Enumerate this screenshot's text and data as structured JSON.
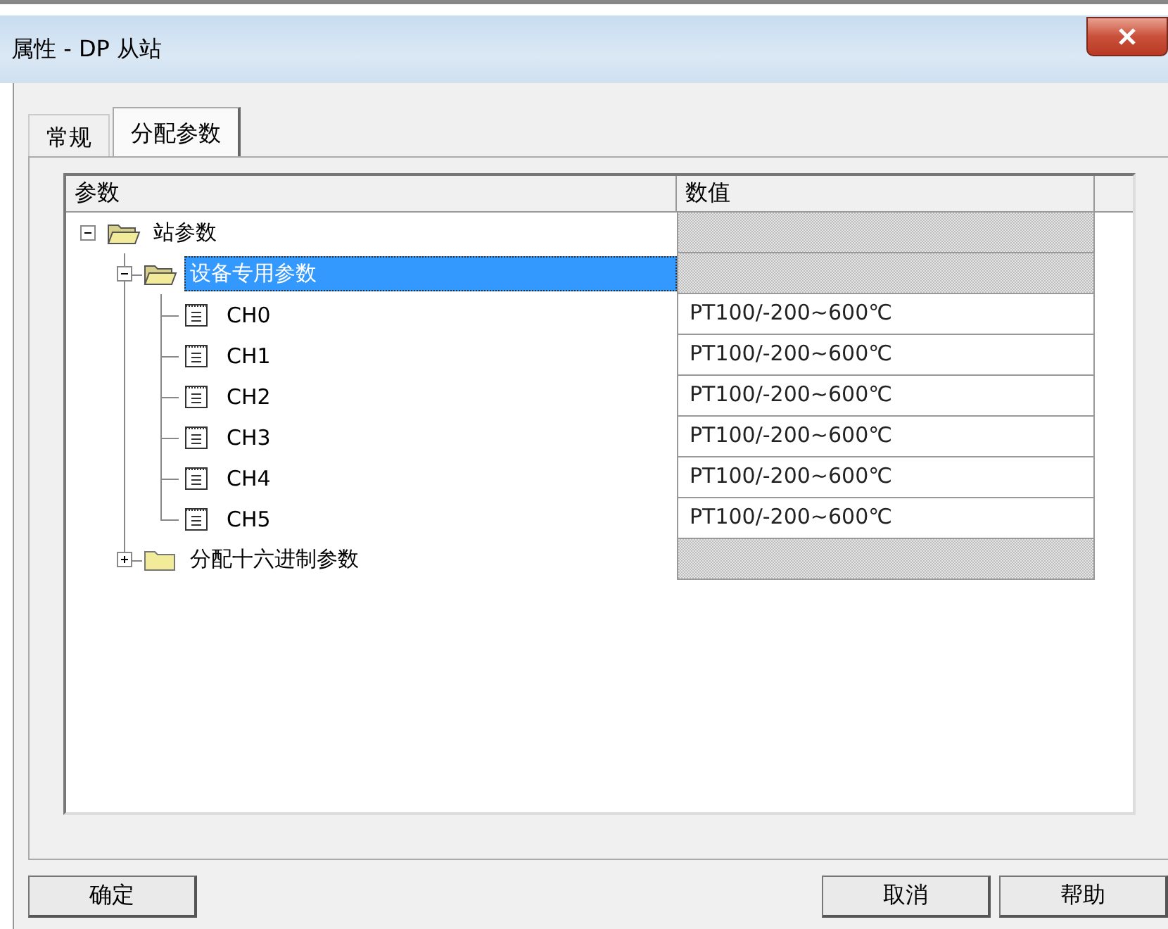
{
  "window": {
    "title": "属性 - DP 从站"
  },
  "tabs": [
    {
      "label": "常规",
      "selected": false
    },
    {
      "label": "分配参数",
      "selected": true
    }
  ],
  "table": {
    "columns": [
      "参数",
      "数值"
    ],
    "tree": [
      {
        "kind": "folder",
        "label": "站参数",
        "expanded": true,
        "selected": false,
        "children": [
          {
            "kind": "folder",
            "label": "设备专用参数",
            "expanded": true,
            "selected": true,
            "children": [
              {
                "kind": "param",
                "label": "CH0",
                "value": "PT100/-200~600℃",
                "selected": false
              },
              {
                "kind": "param",
                "label": "CH1",
                "value": "PT100/-200~600℃",
                "selected": false
              },
              {
                "kind": "param",
                "label": "CH2",
                "value": "PT100/-200~600℃",
                "selected": false
              },
              {
                "kind": "param",
                "label": "CH3",
                "value": "PT100/-200~600℃",
                "selected": false
              },
              {
                "kind": "param",
                "label": "CH4",
                "value": "PT100/-200~600℃",
                "selected": false
              },
              {
                "kind": "param",
                "label": "CH5",
                "value": "PT100/-200~600℃",
                "selected": false
              }
            ]
          },
          {
            "kind": "folder",
            "label": "分配十六进制参数",
            "expanded": false,
            "selected": false
          }
        ]
      }
    ]
  },
  "buttons": [
    {
      "label": "确定"
    },
    {
      "label": "取消"
    },
    {
      "label": "帮助"
    }
  ]
}
